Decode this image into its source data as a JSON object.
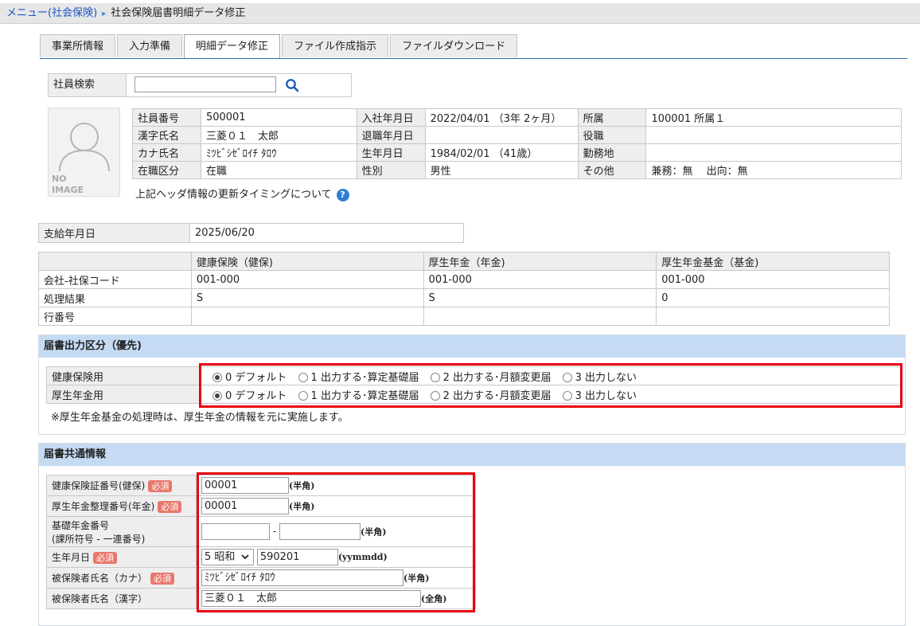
{
  "breadcrumb": {
    "link": "メニュー(社会保険)",
    "sep": "▸",
    "current": "社会保険届書明細データ修正"
  },
  "tabs": [
    "事業所情報",
    "入力準備",
    "明細データ修正",
    "ファイル作成指示",
    "ファイルダウンロード"
  ],
  "active_tab": 2,
  "search": {
    "label": "社員検索",
    "value": ""
  },
  "photo": {
    "line1": "NO",
    "line2": "IMAGE"
  },
  "employee": {
    "rows": [
      [
        "社員番号",
        "500001",
        "入社年月日",
        "2022/04/01 （3年 2ヶ月）",
        "所属",
        "100001 所属１"
      ],
      [
        "漢字氏名",
        "三菱０１　太郎",
        "退職年月日",
        "",
        "役職",
        ""
      ],
      [
        "カナ氏名",
        "ﾐﾂﾋﾞｼｾﾞﾛｲﾁ ﾀﾛｳ",
        "生年月日",
        "1984/02/01 （41歳）",
        "勤務地",
        ""
      ],
      [
        "在職区分",
        "在職",
        "性別",
        "男性",
        "その他",
        "兼務：無　 出向：無"
      ]
    ],
    "help_text": "上記ヘッダ情報の更新タイミングについて",
    "help_icon": "?"
  },
  "payment": {
    "label": "支給年月日",
    "value": "2025/06/20"
  },
  "insurance": {
    "headers": [
      "",
      "健康保険（健保)",
      "厚生年金（年金)",
      "厚生年金基金（基金)"
    ],
    "rows": [
      [
        "会社-社保コード",
        "001-000",
        "001-000",
        "001-000"
      ],
      [
        "処理結果",
        "S",
        "S",
        "0"
      ],
      [
        "行番号",
        "",
        "",
        ""
      ]
    ]
  },
  "output_section": {
    "title": "届書出力区分（優先)",
    "rows": [
      {
        "label": "健康保険用",
        "selected": 0
      },
      {
        "label": "厚生年金用",
        "selected": 0
      }
    ],
    "options": [
      "0 デフォルト",
      "1 出力する･算定基礎届",
      "2 出力する･月額変更届",
      "3 出力しない"
    ],
    "note": "※厚生年金基金の処理時は、厚生年金の情報を元に実施します。"
  },
  "common_section": {
    "title": "届書共通情報",
    "required_badge": "必須",
    "fields": {
      "health_label": "健康保険証番号(健保)",
      "health_value": "00001",
      "health_unit": "(半角)",
      "pension_label": "厚生年金整理番号(年金)",
      "pension_value": "00001",
      "pension_unit": "(半角)",
      "basic_label1": "基礎年金番号",
      "basic_label2": "(課所符号 - 一連番号)",
      "basic_a": "",
      "basic_dash": "-",
      "basic_b": "",
      "basic_unit": "(半角)",
      "birth_label": "生年月日",
      "birth_era": "5 昭和",
      "birth_value": "590201",
      "birth_unit": "(yymmdd)",
      "kana_label": "被保険者氏名（カナ）",
      "kana_value": "ﾐﾂﾋﾞｼｾﾞﾛｲﾁ ﾀﾛｳ",
      "kana_unit": "(半角)",
      "kanji_label": "被保険者氏名（漢字）",
      "kanji_value": "三菱０１　太郎",
      "kanji_unit": "(全角)"
    }
  },
  "colors": {
    "link": "#1a55c8",
    "section_header": "#c5dbf3",
    "highlight": "#e60012",
    "required": "#e9776c"
  }
}
